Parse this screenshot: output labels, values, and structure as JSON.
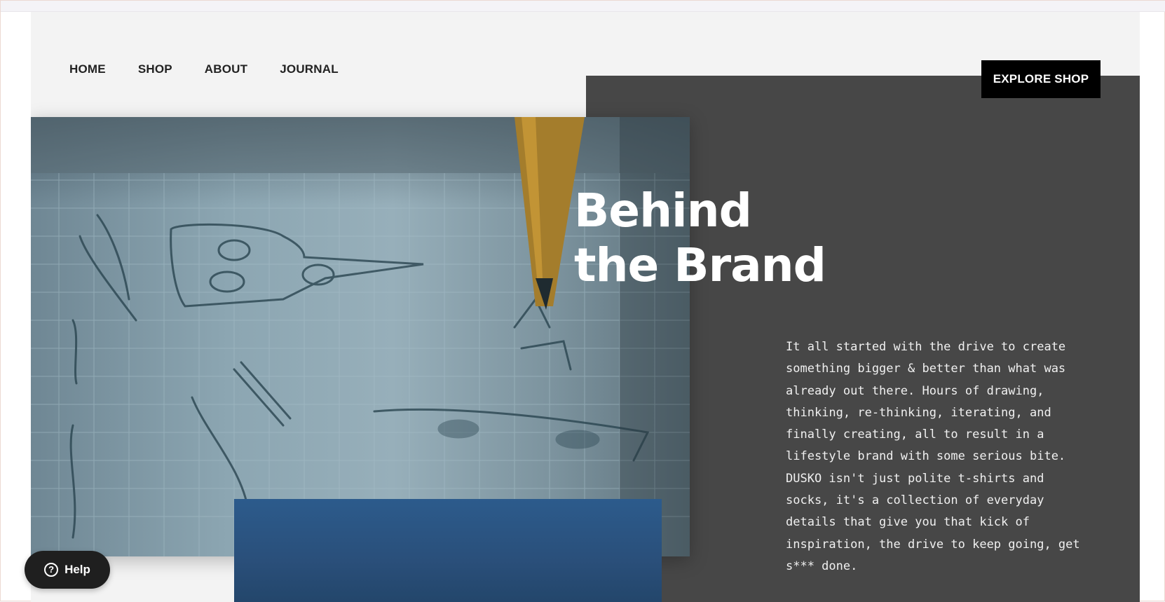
{
  "nav": {
    "items": [
      {
        "label": "HOME"
      },
      {
        "label": "SHOP"
      },
      {
        "label": "ABOUT"
      },
      {
        "label": "JOURNAL"
      }
    ]
  },
  "header": {
    "cta_label": "EXPLORE SHOP"
  },
  "hero": {
    "title_line1": "Behind",
    "title_line2": "the Brand",
    "body": "It all started with the drive to create something bigger & better than what was already out there. Hours of drawing, thinking, re-thinking, iterating, and finally creating, all to result in a lifestyle brand with some serious bite. DUSKO isn't just polite t-shirts and socks, it's a collection of everyday details that give you that kick of inspiration, the drive to keep going, get s*** done."
  },
  "help": {
    "label": "Help",
    "icon": "question-circle-icon"
  },
  "colors": {
    "panel": "#474747",
    "cta_bg": "#000000",
    "help_bg": "#1f1f1f",
    "blue_block": "#2c5b8c"
  }
}
